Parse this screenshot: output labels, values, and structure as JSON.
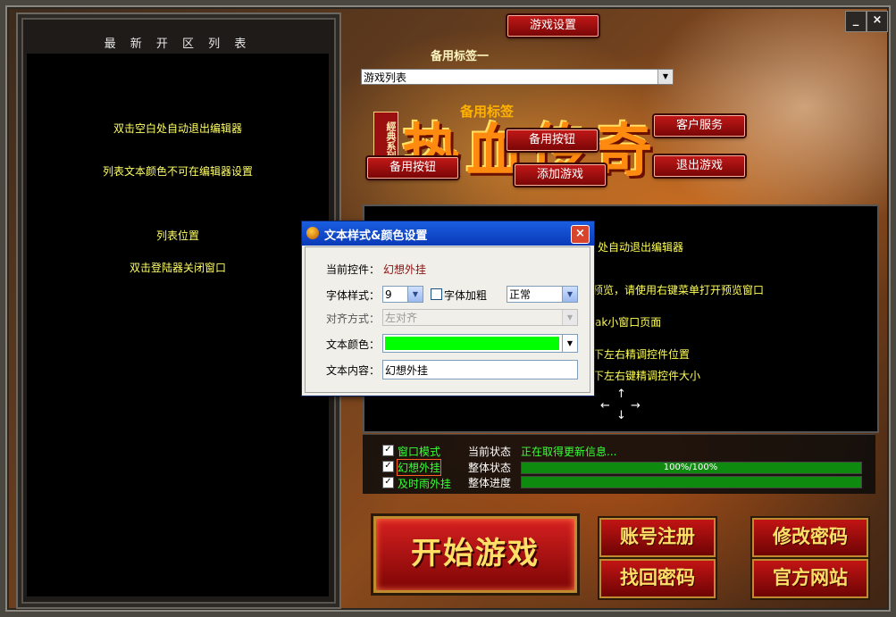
{
  "window": {
    "minimize_label": "_",
    "close_label": "×"
  },
  "left_panel": {
    "title": "最 新 开 区 列 表",
    "lines": [
      "双击空白处自动退出编辑器",
      "列表文本颜色不可在编辑器设置",
      "列表位置",
      "双击登陆器关闭窗口"
    ]
  },
  "top": {
    "settings_button": "游戏设置",
    "tab_label": "备用标签一",
    "tab_label_2": "备用标签",
    "game_list_value": "游戏列表"
  },
  "logo": {
    "seal_text": "經典系列",
    "title": "热血传奇"
  },
  "red_buttons": {
    "backup_button_1": "备用按钮",
    "backup_button_2": "备用按钮",
    "add_game": "添加游戏",
    "customer_service": "客户服务",
    "exit_game": "退出游戏"
  },
  "info_panel": {
    "lines": [
      "处自动退出编辑器",
      "预览，请使用右键菜单打开预览窗口",
      "ak小窗口页面",
      "下左右精调控件位置",
      "下左右键精调控件大小"
    ]
  },
  "status": {
    "checkboxes": [
      {
        "label": "窗口模式",
        "checked": true
      },
      {
        "label": "幻想外挂",
        "checked": true
      },
      {
        "label": "及时雨外挂",
        "checked": true
      }
    ],
    "current_status_label": "当前状态",
    "current_status_value": "正在取得更新信息...",
    "overall_status_label": "整体状态",
    "overall_status_value": "100%/100%",
    "overall_progress_label": "整体进度",
    "progress_1": 1.0,
    "progress_2": 1.0
  },
  "big_buttons": {
    "start_game": "开始游戏",
    "register": "账号注册",
    "change_password": "修改密码",
    "recover_password": "找回密码",
    "official_site": "官方网站"
  },
  "dialog": {
    "title": "文本样式&颜色设置",
    "close_label": "×",
    "current_control_label": "当前控件：",
    "current_control_value": "幻想外挂",
    "font_style_label": "字体样式：",
    "font_size_value": "9",
    "bold_label": "字体加粗",
    "bold_checked": false,
    "weight_value": "正常",
    "align_label": "对齐方式：",
    "align_value": "左对齐",
    "text_color_label": "文本颜色：",
    "text_color_value": "#00ff00",
    "text_content_label": "文本内容：",
    "text_content_value": "幻想外挂"
  },
  "colors": {
    "accent_red": "#b01010",
    "list_text": "#ffff66",
    "status_green": "#38ff38"
  }
}
